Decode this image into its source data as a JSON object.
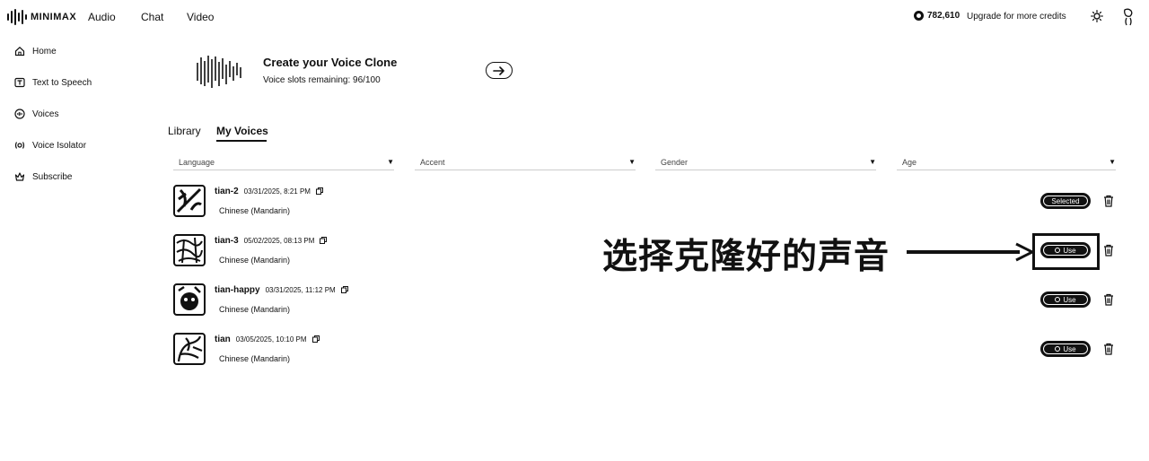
{
  "header": {
    "logo_text": "MINIMAX",
    "nav": [
      "Audio",
      "Chat",
      "Video"
    ],
    "credits": "782,610",
    "upgrade_label": "Upgrade for more credits"
  },
  "sidebar": {
    "items": [
      {
        "label": "Home",
        "icon": "home-icon"
      },
      {
        "label": "Text to Speech",
        "icon": "text-to-speech-icon"
      },
      {
        "label": "Voices",
        "icon": "voices-icon"
      },
      {
        "label": "Voice Isolator",
        "icon": "voice-isolator-icon"
      },
      {
        "label": "Subscribe",
        "icon": "subscribe-icon"
      }
    ]
  },
  "clone": {
    "title": "Create your Voice Clone",
    "subtitle": "Voice slots remaining: 96/100"
  },
  "tabs": {
    "library": "Library",
    "my_voices": "My Voices",
    "active": "My Voices"
  },
  "filters": [
    "Language",
    "Accent",
    "Gender",
    "Age"
  ],
  "voices": [
    {
      "name": "tian-2",
      "date": "03/31/2025, 8:21 PM",
      "language": "Chinese (Mandarin)",
      "action": "Selected"
    },
    {
      "name": "tian-3",
      "date": "05/02/2025, 08:13 PM",
      "language": "Chinese (Mandarin)",
      "action": "Use"
    },
    {
      "name": "tian-happy",
      "date": "03/31/2025, 11:12 PM",
      "language": "Chinese (Mandarin)",
      "action": "Use"
    },
    {
      "name": "tian",
      "date": "03/05/2025, 10:10 PM",
      "language": "Chinese (Mandarin)",
      "action": "Use"
    }
  ],
  "annotation": {
    "text": "选择克隆好的声音"
  },
  "colors": {
    "ink": "#111111",
    "background": "#ffffff"
  }
}
